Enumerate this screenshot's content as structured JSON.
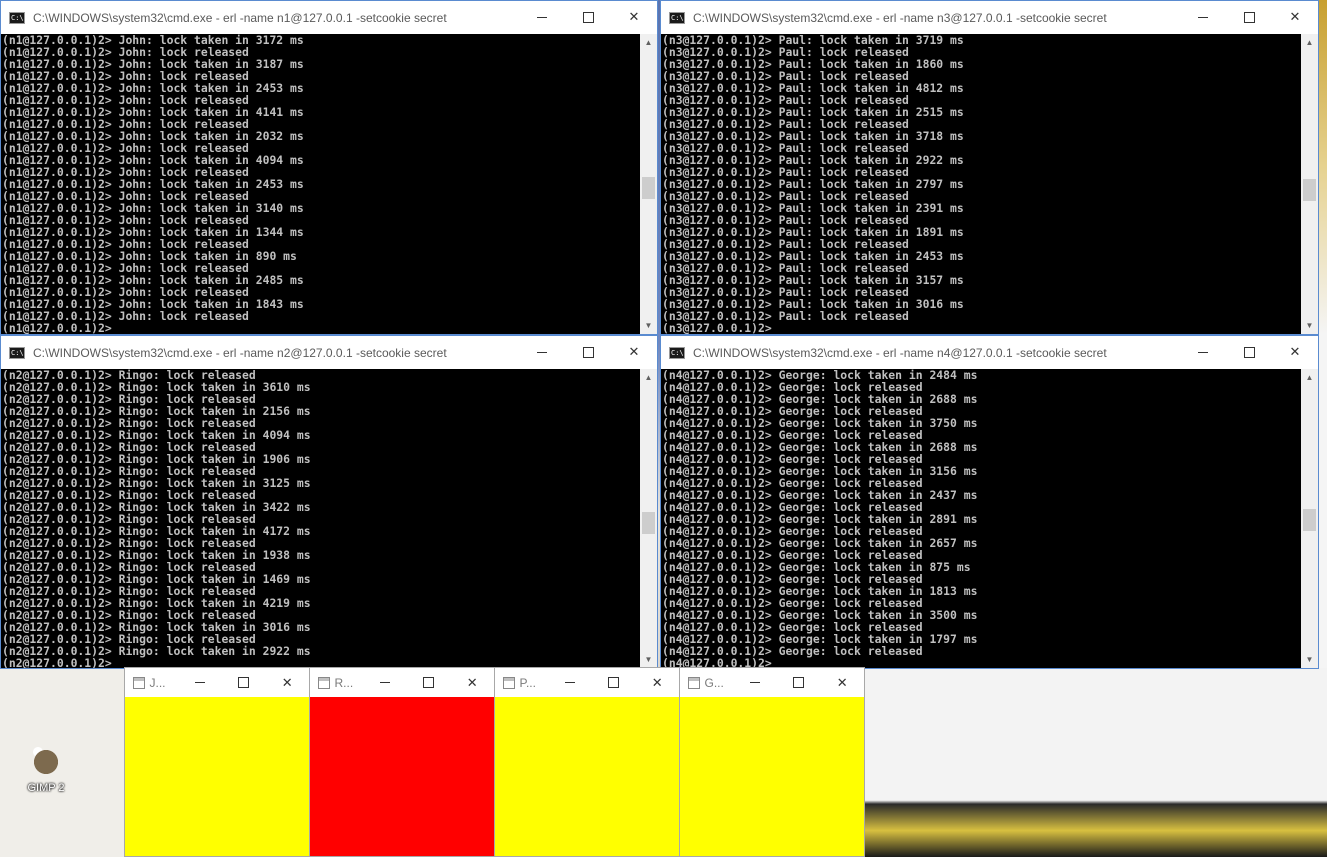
{
  "desktop": {
    "icon_label": "GIMP 2"
  },
  "windows": [
    {
      "id": "n1",
      "title": "C:\\WINDOWS\\system32\\cmd.exe - erl  -name n1@127.0.0.1 -setcookie secret",
      "lines": [
        "(n1@127.0.0.1)2> John: lock taken in 3172 ms",
        "(n1@127.0.0.1)2> John: lock released",
        "(n1@127.0.0.1)2> John: lock taken in 3187 ms",
        "(n1@127.0.0.1)2> John: lock released",
        "(n1@127.0.0.1)2> John: lock taken in 2453 ms",
        "(n1@127.0.0.1)2> John: lock released",
        "(n1@127.0.0.1)2> John: lock taken in 4141 ms",
        "(n1@127.0.0.1)2> John: lock released",
        "(n1@127.0.0.1)2> John: lock taken in 2032 ms",
        "(n1@127.0.0.1)2> John: lock released",
        "(n1@127.0.0.1)2> John: lock taken in 4094 ms",
        "(n1@127.0.0.1)2> John: lock released",
        "(n1@127.0.0.1)2> John: lock taken in 2453 ms",
        "(n1@127.0.0.1)2> John: lock released",
        "(n1@127.0.0.1)2> John: lock taken in 3140 ms",
        "(n1@127.0.0.1)2> John: lock released",
        "(n1@127.0.0.1)2> John: lock taken in 1344 ms",
        "(n1@127.0.0.1)2> John: lock released",
        "(n1@127.0.0.1)2> John: lock taken in 890 ms",
        "(n1@127.0.0.1)2> John: lock released",
        "(n1@127.0.0.1)2> John: lock taken in 2485 ms",
        "(n1@127.0.0.1)2> John: lock released",
        "(n1@127.0.0.1)2> John: lock taken in 1843 ms",
        "(n1@127.0.0.1)2> John: lock released",
        "(n1@127.0.0.1)2>"
      ]
    },
    {
      "id": "n3",
      "title": "C:\\WINDOWS\\system32\\cmd.exe - erl  -name n3@127.0.0.1 -setcookie secret",
      "lines": [
        "(n3@127.0.0.1)2> Paul: lock taken in 3719 ms",
        "(n3@127.0.0.1)2> Paul: lock released",
        "(n3@127.0.0.1)2> Paul: lock taken in 1860 ms",
        "(n3@127.0.0.1)2> Paul: lock released",
        "(n3@127.0.0.1)2> Paul: lock taken in 4812 ms",
        "(n3@127.0.0.1)2> Paul: lock released",
        "(n3@127.0.0.1)2> Paul: lock taken in 2515 ms",
        "(n3@127.0.0.1)2> Paul: lock released",
        "(n3@127.0.0.1)2> Paul: lock taken in 3718 ms",
        "(n3@127.0.0.1)2> Paul: lock released",
        "(n3@127.0.0.1)2> Paul: lock taken in 2922 ms",
        "(n3@127.0.0.1)2> Paul: lock released",
        "(n3@127.0.0.1)2> Paul: lock taken in 2797 ms",
        "(n3@127.0.0.1)2> Paul: lock released",
        "(n3@127.0.0.1)2> Paul: lock taken in 2391 ms",
        "(n3@127.0.0.1)2> Paul: lock released",
        "(n3@127.0.0.1)2> Paul: lock taken in 1891 ms",
        "(n3@127.0.0.1)2> Paul: lock released",
        "(n3@127.0.0.1)2> Paul: lock taken in 2453 ms",
        "(n3@127.0.0.1)2> Paul: lock released",
        "(n3@127.0.0.1)2> Paul: lock taken in 3157 ms",
        "(n3@127.0.0.1)2> Paul: lock released",
        "(n3@127.0.0.1)2> Paul: lock taken in 3016 ms",
        "(n3@127.0.0.1)2> Paul: lock released",
        "(n3@127.0.0.1)2>"
      ]
    },
    {
      "id": "n2",
      "title": "C:\\WINDOWS\\system32\\cmd.exe - erl  -name n2@127.0.0.1 -setcookie secret",
      "lines": [
        "(n2@127.0.0.1)2> Ringo: lock released",
        "(n2@127.0.0.1)2> Ringo: lock taken in 3610 ms",
        "(n2@127.0.0.1)2> Ringo: lock released",
        "(n2@127.0.0.1)2> Ringo: lock taken in 2156 ms",
        "(n2@127.0.0.1)2> Ringo: lock released",
        "(n2@127.0.0.1)2> Ringo: lock taken in 4094 ms",
        "(n2@127.0.0.1)2> Ringo: lock released",
        "(n2@127.0.0.1)2> Ringo: lock taken in 1906 ms",
        "(n2@127.0.0.1)2> Ringo: lock released",
        "(n2@127.0.0.1)2> Ringo: lock taken in 3125 ms",
        "(n2@127.0.0.1)2> Ringo: lock released",
        "(n2@127.0.0.1)2> Ringo: lock taken in 3422 ms",
        "(n2@127.0.0.1)2> Ringo: lock released",
        "(n2@127.0.0.1)2> Ringo: lock taken in 4172 ms",
        "(n2@127.0.0.1)2> Ringo: lock released",
        "(n2@127.0.0.1)2> Ringo: lock taken in 1938 ms",
        "(n2@127.0.0.1)2> Ringo: lock released",
        "(n2@127.0.0.1)2> Ringo: lock taken in 1469 ms",
        "(n2@127.0.0.1)2> Ringo: lock released",
        "(n2@127.0.0.1)2> Ringo: lock taken in 4219 ms",
        "(n2@127.0.0.1)2> Ringo: lock released",
        "(n2@127.0.0.1)2> Ringo: lock taken in 3016 ms",
        "(n2@127.0.0.1)2> Ringo: lock released",
        "(n2@127.0.0.1)2> Ringo: lock taken in 2922 ms",
        "(n2@127.0.0.1)2>"
      ]
    },
    {
      "id": "n4",
      "title": "C:\\WINDOWS\\system32\\cmd.exe - erl  -name n4@127.0.0.1 -setcookie secret",
      "lines": [
        "(n4@127.0.0.1)2> George: lock taken in 2484 ms",
        "(n4@127.0.0.1)2> George: lock released",
        "(n4@127.0.0.1)2> George: lock taken in 2688 ms",
        "(n4@127.0.0.1)2> George: lock released",
        "(n4@127.0.0.1)2> George: lock taken in 3750 ms",
        "(n4@127.0.0.1)2> George: lock released",
        "(n4@127.0.0.1)2> George: lock taken in 2688 ms",
        "(n4@127.0.0.1)2> George: lock released",
        "(n4@127.0.0.1)2> George: lock taken in 3156 ms",
        "(n4@127.0.0.1)2> George: lock released",
        "(n4@127.0.0.1)2> George: lock taken in 2437 ms",
        "(n4@127.0.0.1)2> George: lock released",
        "(n4@127.0.0.1)2> George: lock taken in 2891 ms",
        "(n4@127.0.0.1)2> George: lock released",
        "(n4@127.0.0.1)2> George: lock taken in 2657 ms",
        "(n4@127.0.0.1)2> George: lock released",
        "(n4@127.0.0.1)2> George: lock taken in 875 ms",
        "(n4@127.0.0.1)2> George: lock released",
        "(n4@127.0.0.1)2> George: lock taken in 1813 ms",
        "(n4@127.0.0.1)2> George: lock released",
        "(n4@127.0.0.1)2> George: lock taken in 3500 ms",
        "(n4@127.0.0.1)2> George: lock released",
        "(n4@127.0.0.1)2> George: lock taken in 1797 ms",
        "(n4@127.0.0.1)2> George: lock released",
        "(n4@127.0.0.1)2>"
      ]
    }
  ],
  "mini_windows": [
    {
      "id": "john",
      "title": "J...",
      "color": "#ffff00"
    },
    {
      "id": "ringo",
      "title": "R...",
      "color": "#ff0000"
    },
    {
      "id": "paul",
      "title": "P...",
      "color": "#ffff00"
    },
    {
      "id": "george",
      "title": "G...",
      "color": "#ffff00"
    }
  ],
  "colors": {
    "console_bg": "#000000",
    "console_fg": "#c0c0c0",
    "window_border": "#5a8bd0"
  }
}
